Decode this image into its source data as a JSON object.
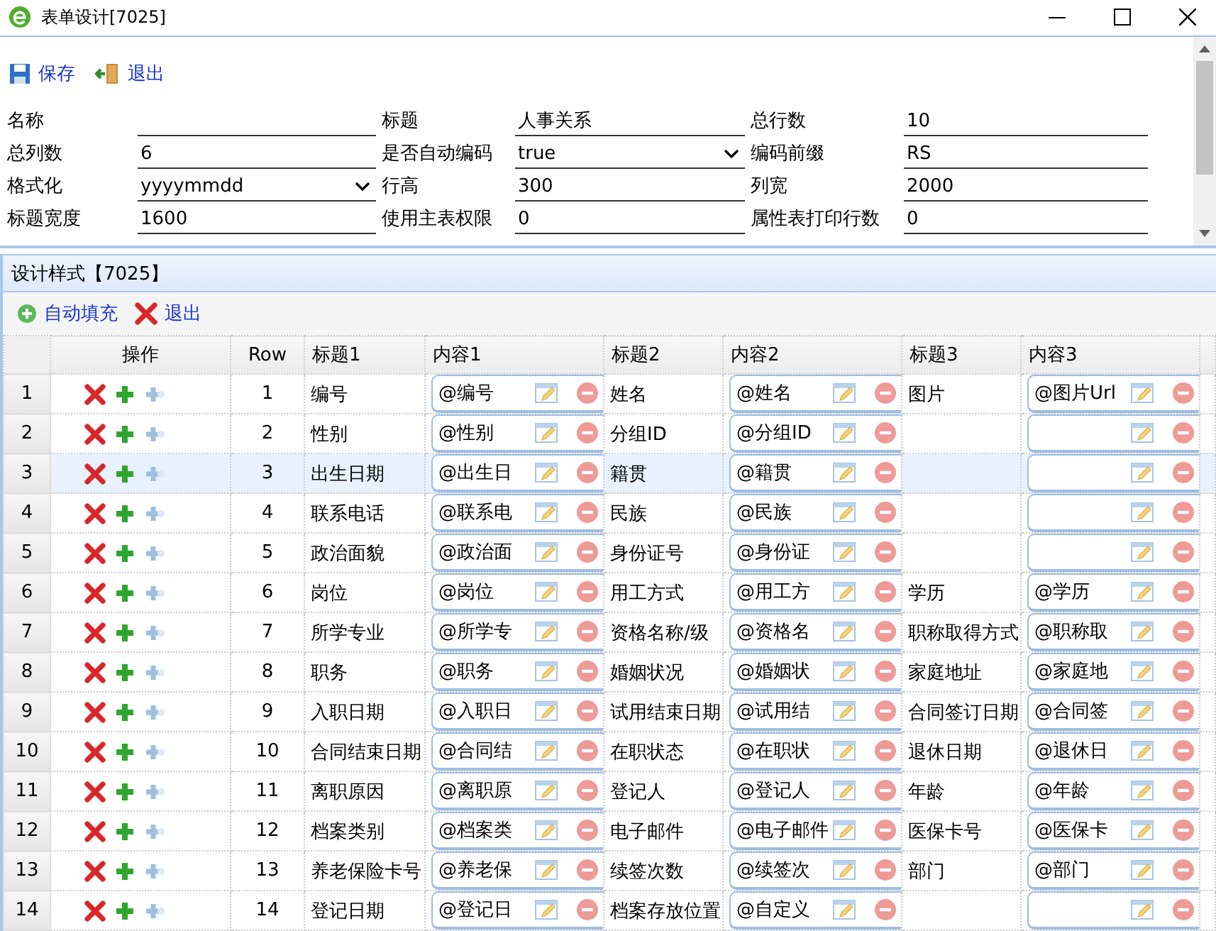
{
  "window": {
    "title": "表单设计[7025]"
  },
  "toolbar": [
    {
      "kind": "save",
      "label": "保存"
    },
    {
      "kind": "exit",
      "label": "退出"
    }
  ],
  "form": {
    "fields": [
      {
        "label": "名称",
        "kind": "text"
      },
      {
        "label": "标题",
        "kind": "text",
        "value": "人事关系"
      },
      {
        "label": "总行数",
        "kind": "text",
        "value": "10"
      },
      {
        "label": "总列数",
        "kind": "text",
        "value": "6"
      },
      {
        "label": "是否自动编码",
        "kind": "select",
        "value": "true"
      },
      {
        "label": "编码前缀",
        "kind": "text",
        "value": "RS"
      },
      {
        "label": "格式化",
        "kind": "select",
        "value": "yyyymmdd"
      },
      {
        "label": "行高",
        "kind": "text",
        "value": "300"
      },
      {
        "label": "列宽",
        "kind": "text",
        "value": "2000"
      },
      {
        "label": "标题宽度",
        "kind": "text",
        "value": "1600"
      },
      {
        "label": "使用主表权限",
        "kind": "text",
        "value": "0"
      },
      {
        "label": "属性表打印行数",
        "kind": "text",
        "value": "0"
      }
    ]
  },
  "panel": {
    "title": "设计样式【7025】",
    "toolbar": [
      {
        "kind": "add",
        "label": "自动填充"
      },
      {
        "kind": "exit",
        "label": "退出"
      }
    ],
    "table": {
      "columns": [
        "操作",
        "Row",
        "标题1",
        "内容1",
        "标题2",
        "内容2",
        "标题3",
        "内容3"
      ],
      "rows": [
        {
          "number": "1",
          "row": "1",
          "selected": false,
          "pairs": [
            {
              "title": "编号",
              "content": "@编号"
            },
            {
              "title": "姓名",
              "content": "@姓名"
            },
            {
              "title": "图片",
              "content": "@图片Url"
            }
          ]
        },
        {
          "number": "2",
          "row": "2",
          "selected": false,
          "pairs": [
            {
              "title": "性别",
              "content": "@性别"
            },
            {
              "title": "分组ID",
              "content": "@分组ID"
            }
          ]
        },
        {
          "number": "3",
          "row": "3",
          "selected": true,
          "pairs": [
            {
              "title": "出生日期",
              "content": "@出生日"
            },
            {
              "title": "籍贯",
              "content": "@籍贯"
            }
          ]
        },
        {
          "number": "4",
          "row": "4",
          "selected": false,
          "pairs": [
            {
              "title": "联系电话",
              "content": "@联系电"
            },
            {
              "title": "民族",
              "content": "@民族"
            }
          ]
        },
        {
          "number": "5",
          "row": "5",
          "selected": false,
          "pairs": [
            {
              "title": "政治面貌",
              "content": "@政治面"
            },
            {
              "title": "身份证号",
              "content": "@身份证"
            }
          ]
        },
        {
          "number": "6",
          "row": "6",
          "selected": false,
          "pairs": [
            {
              "title": "岗位",
              "content": "@岗位"
            },
            {
              "title": "用工方式",
              "content": "@用工方"
            },
            {
              "title": "学历",
              "content": "@学历"
            }
          ]
        },
        {
          "number": "7",
          "row": "7",
          "selected": false,
          "pairs": [
            {
              "title": "所学专业",
              "content": "@所学专"
            },
            {
              "title": "资格名称/级",
              "content": "@资格名"
            },
            {
              "title": "职称取得方式",
              "content": "@职称取"
            }
          ]
        },
        {
          "number": "8",
          "row": "8",
          "selected": false,
          "pairs": [
            {
              "title": "职务",
              "content": "@职务"
            },
            {
              "title": "婚姻状况",
              "content": "@婚姻状"
            },
            {
              "title": "家庭地址",
              "content": "@家庭地"
            }
          ]
        },
        {
          "number": "9",
          "row": "9",
          "selected": false,
          "pairs": [
            {
              "title": "入职日期",
              "content": "@入职日"
            },
            {
              "title": "试用结束日期",
              "content": "@试用结"
            },
            {
              "title": "合同签订日期",
              "content": "@合同签"
            }
          ]
        },
        {
          "number": "10",
          "row": "10",
          "selected": false,
          "pairs": [
            {
              "title": "合同结束日期",
              "content": "@合同结"
            },
            {
              "title": "在职状态",
              "content": "@在职状"
            },
            {
              "title": "退休日期",
              "content": "@退休日"
            }
          ]
        },
        {
          "number": "11",
          "row": "11",
          "selected": false,
          "pairs": [
            {
              "title": "离职原因",
              "content": "@离职原"
            },
            {
              "title": "登记人",
              "content": "@登记人"
            },
            {
              "title": "年龄",
              "content": "@年龄"
            }
          ]
        },
        {
          "number": "12",
          "row": "12",
          "selected": false,
          "pairs": [
            {
              "title": "档案类别",
              "content": "@档案类"
            },
            {
              "title": "电子邮件",
              "content": "@电子邮件"
            },
            {
              "title": "医保卡号",
              "content": "@医保卡"
            }
          ]
        },
        {
          "number": "13",
          "row": "13",
          "selected": false,
          "pairs": [
            {
              "title": "养老保险卡号",
              "content": "@养老保"
            },
            {
              "title": "续签次数",
              "content": "@续签次"
            },
            {
              "title": "部门",
              "content": "@部门"
            }
          ]
        },
        {
          "number": "14",
          "row": "14",
          "selected": false,
          "pairs": [
            {
              "title": "登记日期",
              "content": "@登记日"
            },
            {
              "title": "档案存放位置",
              "content": "@自定义"
            }
          ]
        }
      ]
    }
  }
}
